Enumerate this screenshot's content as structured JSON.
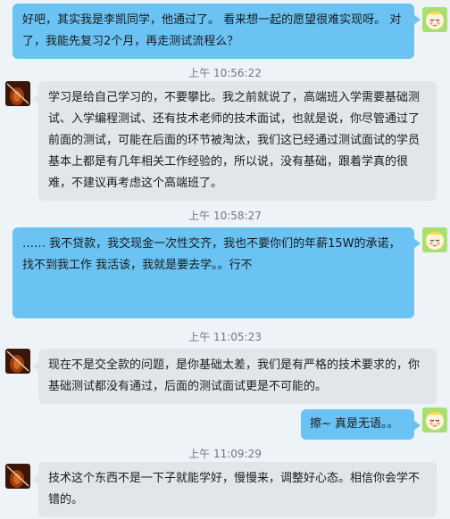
{
  "messages": [
    {
      "text": "好吧，其实我是李凯同学，他通过了。 看来想一起的愿望很难实现呀。 对了，我能先复习2个月，再走测试流程么？"
    },
    {
      "text": "学习是给自己学习的，不要攀比。我之前就说了，高端班入学需要基础测试、入学编程测试、还有技术老师的技术面试，也就是说，你尽管通过了前面的测试，可能在后面的环节被淘汰，我们这已经通过测试面试的学员基本上都是有几年相关工作经验的，所以说，没有基础，跟着学真的很难，不建议再考虑这个高端班了。"
    },
    {
      "text": "…… 我不贷款，我交现金一次性交齐，我也不要你们的年薪15W的承诺，找不到我工作 我活该，我就是要去学。。行不"
    },
    {
      "text": "现在不是交全款的问题，是你基础太差，我们是有严格的技术要求的，你基础测试都没有通过，后面的测试面试更是不可能的。"
    },
    {
      "text": "擦~  真是无语。。"
    },
    {
      "text": "技术这个东西不是一下子就能学好，慢慢来，调整好心态。相信你会学不错的。"
    }
  ],
  "timestamps": [
    "上午 10:56:22",
    "上午 10:58:27",
    "上午 11:05:23",
    "上午 11:09:29"
  ],
  "colors": {
    "my_bubble": "#6ac3f3",
    "their_bubble": "#e2e6ea",
    "background": "#eef3f8"
  },
  "icons": {
    "me_avatar": "cartoon-face-avatar",
    "them_avatar": "violin-avatar"
  }
}
